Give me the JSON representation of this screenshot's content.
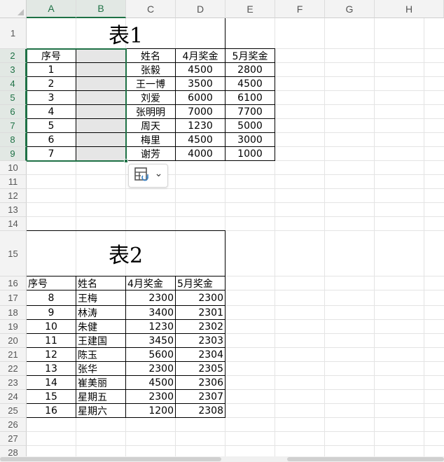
{
  "columns": [
    "A",
    "B",
    "C",
    "D",
    "E",
    "F",
    "G",
    "H"
  ],
  "rows": [
    "1",
    "2",
    "3",
    "4",
    "5",
    "6",
    "7",
    "8",
    "9",
    "10",
    "11",
    "12",
    "13",
    "14",
    "15",
    "16",
    "17",
    "18",
    "19",
    "20",
    "21",
    "22",
    "23",
    "24",
    "25",
    "26",
    "27",
    "28"
  ],
  "table1": {
    "title": "表1",
    "headers": [
      "序号",
      "",
      "姓名",
      "4月奖金",
      "5月奖金"
    ],
    "rows": [
      [
        "1",
        "",
        "张毅",
        "4500",
        "2800"
      ],
      [
        "2",
        "",
        "王一博",
        "3500",
        "4500"
      ],
      [
        "3",
        "",
        "刘爱",
        "6000",
        "6100"
      ],
      [
        "4",
        "",
        "张明明",
        "7000",
        "7700"
      ],
      [
        "5",
        "",
        "周天",
        "1230",
        "5000"
      ],
      [
        "6",
        "",
        "梅里",
        "4500",
        "3000"
      ],
      [
        "7",
        "",
        "谢芳",
        "4000",
        "1000"
      ]
    ]
  },
  "table2": {
    "title": "表2",
    "headers": [
      "序号",
      "姓名",
      "4月奖金",
      "5月奖金"
    ],
    "rows": [
      [
        "8",
        "王梅",
        "2300",
        "2300"
      ],
      [
        "9",
        "林涛",
        "3400",
        "2301"
      ],
      [
        "10",
        "朱健",
        "1230",
        "2302"
      ],
      [
        "11",
        "王建国",
        "3450",
        "2303"
      ],
      [
        "12",
        "陈玉",
        "5600",
        "2304"
      ],
      [
        "13",
        "张华",
        "2300",
        "2305"
      ],
      [
        "14",
        "崔美丽",
        "4500",
        "2306"
      ],
      [
        "15",
        "星期五",
        "2300",
        "2307"
      ],
      [
        "16",
        "星期六",
        "1200",
        "2308"
      ]
    ]
  },
  "paste_options": {
    "icon": "paste-options-icon",
    "caret": "⌄"
  },
  "colors": {
    "selection": "#1e7145",
    "header_bg": "#f3f3f3",
    "selected_fill": "#e6e6e6"
  }
}
